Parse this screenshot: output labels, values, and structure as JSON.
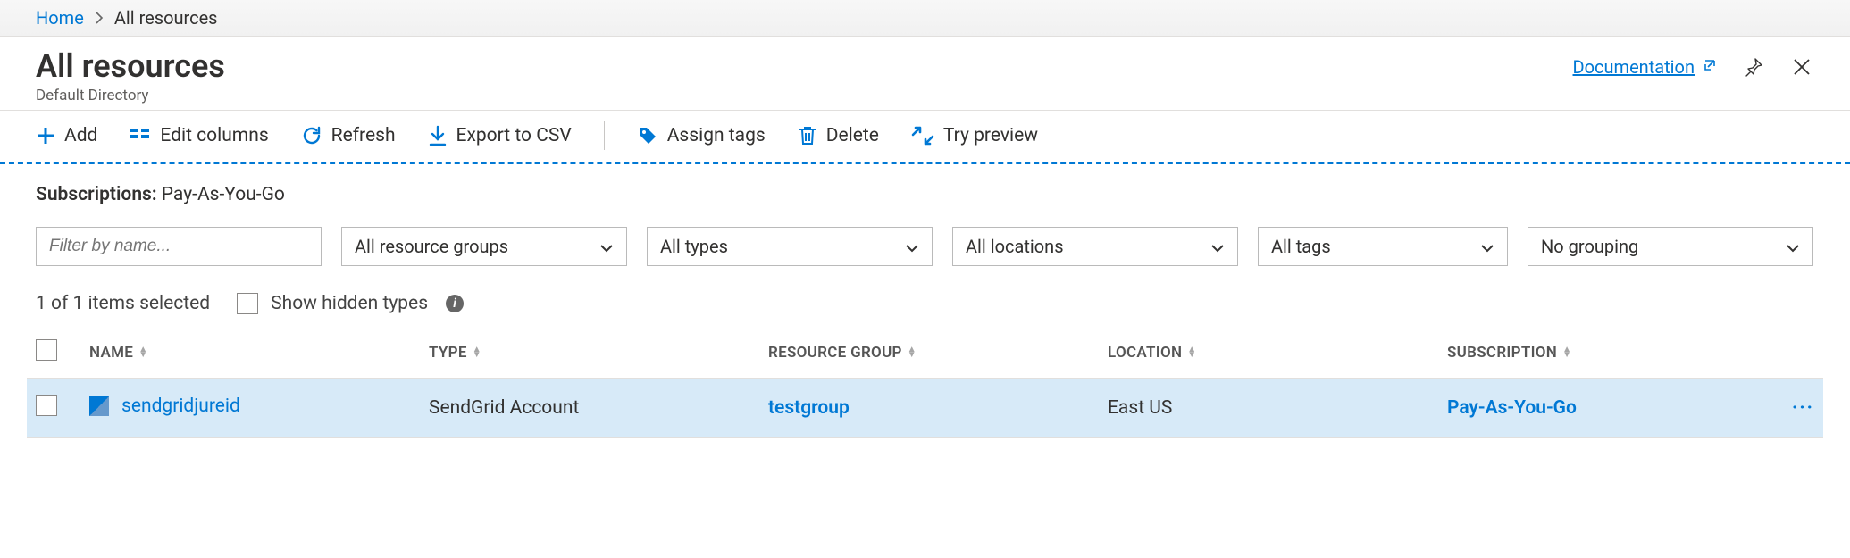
{
  "breadcrumb": {
    "home": "Home",
    "current": "All resources"
  },
  "header": {
    "title": "All resources",
    "subtitle": "Default Directory",
    "documentation": "Documentation"
  },
  "toolbar": {
    "add": "Add",
    "edit_columns": "Edit columns",
    "refresh": "Refresh",
    "export_csv": "Export to CSV",
    "assign_tags": "Assign tags",
    "delete": "Delete",
    "try_preview": "Try preview"
  },
  "subscriptions": {
    "label": "Subscriptions:",
    "value": "Pay-As-You-Go"
  },
  "filters": {
    "name_placeholder": "Filter by name...",
    "resource_groups": "All resource groups",
    "types": "All types",
    "locations": "All locations",
    "tags": "All tags",
    "grouping": "No grouping"
  },
  "meta": {
    "selected_text": "1 of 1 items selected",
    "show_hidden": "Show hidden types"
  },
  "columns": {
    "name": "NAME",
    "type": "TYPE",
    "resource_group": "RESOURCE GROUP",
    "location": "LOCATION",
    "subscription": "SUBSCRIPTION"
  },
  "rows": [
    {
      "name": "sendgridjureid",
      "type": "SendGrid Account",
      "resource_group": "testgroup",
      "location": "East US",
      "subscription": "Pay-As-You-Go"
    }
  ]
}
